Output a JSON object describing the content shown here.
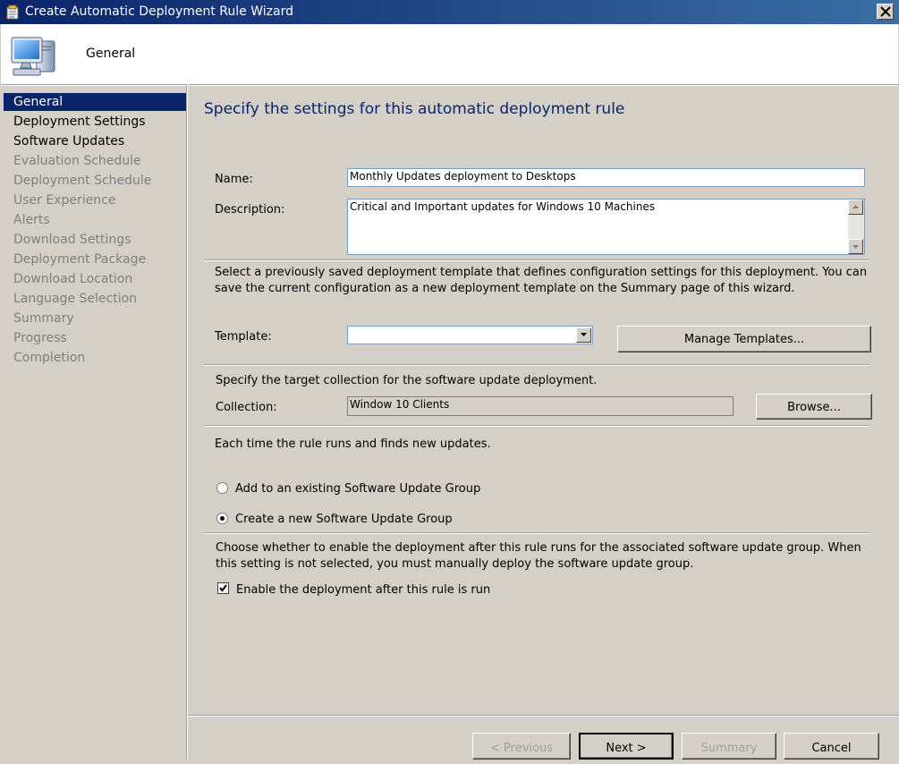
{
  "window": {
    "title": "Create Automatic Deployment Rule Wizard"
  },
  "header": {
    "page_title": "General"
  },
  "nav": {
    "items": [
      {
        "label": "General",
        "state": "selected"
      },
      {
        "label": "Deployment Settings",
        "state": "enabled"
      },
      {
        "label": "Software Updates",
        "state": "enabled"
      },
      {
        "label": "Evaluation Schedule",
        "state": "disabled"
      },
      {
        "label": "Deployment Schedule",
        "state": "disabled"
      },
      {
        "label": "User Experience",
        "state": "disabled"
      },
      {
        "label": "Alerts",
        "state": "disabled"
      },
      {
        "label": "Download Settings",
        "state": "disabled"
      },
      {
        "label": "Deployment Package",
        "state": "disabled"
      },
      {
        "label": "Download Location",
        "state": "disabled"
      },
      {
        "label": "Language Selection",
        "state": "disabled"
      },
      {
        "label": "Summary",
        "state": "disabled"
      },
      {
        "label": "Progress",
        "state": "disabled"
      },
      {
        "label": "Completion",
        "state": "disabled"
      }
    ]
  },
  "content": {
    "title": "Specify the settings for this automatic deployment rule",
    "name_label": "Name:",
    "name_value": "Monthly Updates deployment to Desktops",
    "description_label": "Description:",
    "description_value": "Critical and Important updates for Windows 10 Machines",
    "template_info": "Select a previously saved deployment template that defines configuration settings for this deployment. You can save the current configuration as a new deployment template on the Summary page of this wizard.",
    "template_label": "Template:",
    "template_value": "",
    "manage_templates_label": "Manage Templates...",
    "collection_info": "Specify the target collection for the software update deployment.",
    "collection_label": "Collection:",
    "collection_value": "Window 10 Clients",
    "browse_label": "Browse...",
    "rule_runs_info": "Each time the rule runs and finds new updates.",
    "radio_existing_label": "Add to an existing Software Update Group",
    "radio_new_label": "Create a new Software Update Group",
    "radio_selected": "new",
    "enable_info": "Choose whether to enable the deployment after this rule runs for the associated software update group. When this setting is not selected, you must manually deploy the software update group.",
    "enable_checkbox_label": "Enable the deployment after this rule is run",
    "enable_checked": true
  },
  "footer": {
    "previous_label": "< Previous",
    "next_label": "Next >",
    "summary_label": "Summary",
    "cancel_label": "Cancel"
  }
}
